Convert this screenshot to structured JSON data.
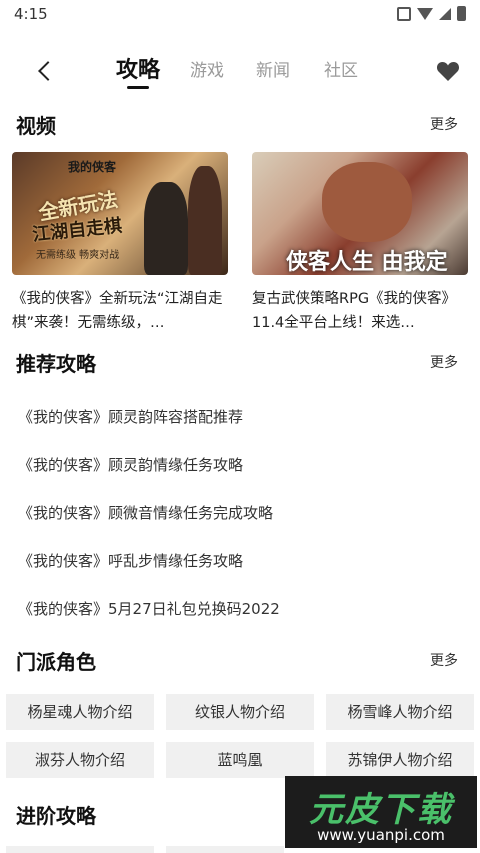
{
  "status_bar": {
    "time": "4:15"
  },
  "nav": {
    "tabs": [
      {
        "label": "攻略",
        "active": true
      },
      {
        "label": "游戏",
        "active": false
      },
      {
        "label": "新闻",
        "active": false
      },
      {
        "label": "社区",
        "active": false
      }
    ]
  },
  "videos": {
    "title": "视频",
    "more": "更多",
    "items": [
      {
        "caption": "《我的侠客》全新玩法“江湖自走棋”来袭！无需练级，…",
        "thumb_text": {
          "a": "全新玩法",
          "b": "江湖自走棋",
          "c": "我的侠客",
          "d": "无需练级 畅爽对战"
        }
      },
      {
        "caption": "复古武侠策略RPG《我的侠客》11.4全平台上线！来选…",
        "thumb_text": {
          "a": "侠客人生 由我定义"
        }
      }
    ]
  },
  "guides": {
    "title": "推荐攻略",
    "more": "更多",
    "items": [
      "《我的侠客》顾灵韵阵容搭配推荐",
      "《我的侠客》顾灵韵情缘任务攻略",
      "《我的侠客》顾微音情缘任务完成攻略",
      "《我的侠客》呼乱步情缘任务攻略",
      "《我的侠客》5月27日礼包兑换码2022"
    ]
  },
  "factions": {
    "title": "门派角色",
    "more": "更多",
    "items": [
      "杨星魂人物介绍",
      "纹银人物介绍",
      "杨雪峰人物介绍",
      "淑芬人物介绍",
      "蓝鸣凰",
      "苏锦伊人物介绍"
    ]
  },
  "advanced": {
    "title": "进阶攻略"
  },
  "watermark": {
    "main": "元皮下载",
    "url": "www.yuanpi.com"
  },
  "colors": {
    "accent": "#111111",
    "muted_tab": "#9a9a9a",
    "chip_bg": "#f0f0f0",
    "watermark_green": "#4ac06a"
  }
}
